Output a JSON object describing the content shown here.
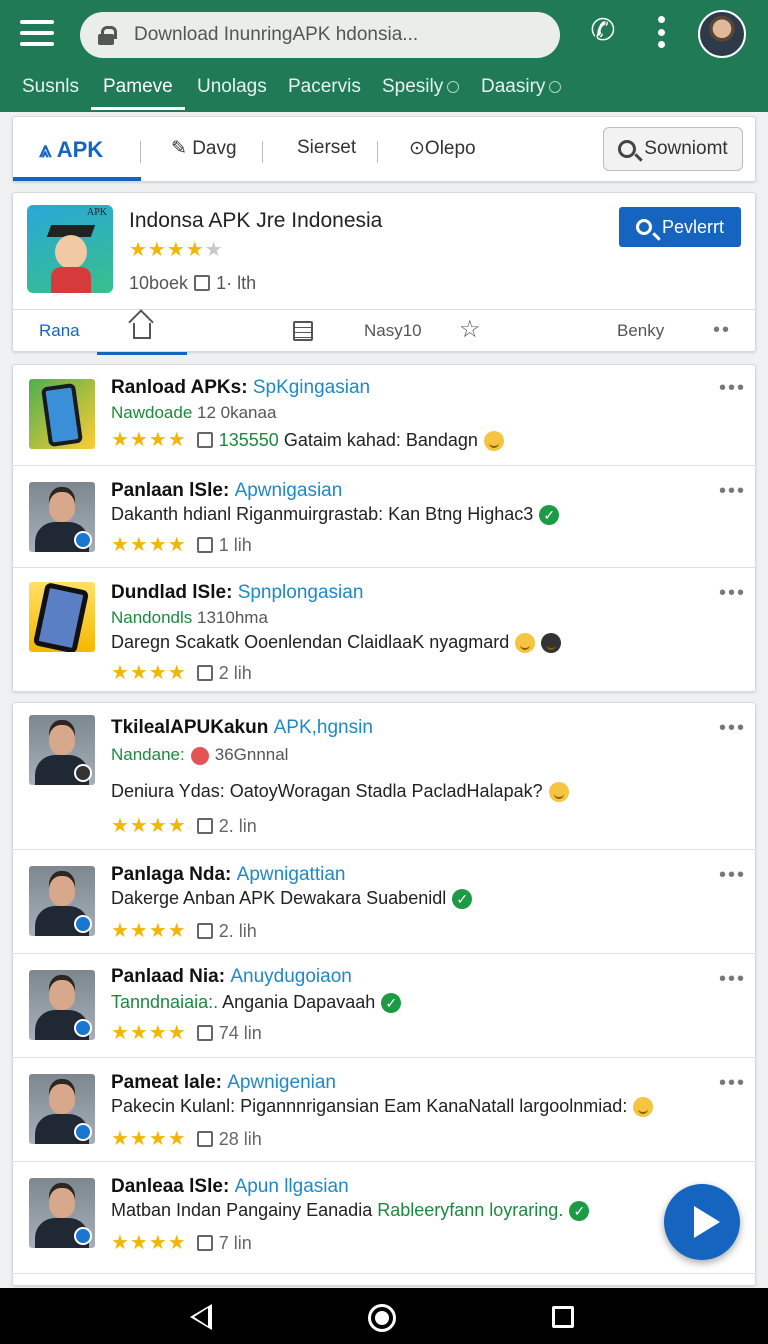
{
  "header": {
    "search_text": "Download InunringAPK hdonsia...",
    "tabs": [
      "Susnls",
      "Pameve",
      "Unolags",
      "Pacervis",
      "Spesily",
      "Daasiry"
    ]
  },
  "subtabs": {
    "apk": "APK",
    "items": [
      "Davg",
      "Sierset",
      "Olepo"
    ],
    "search_button": "Sowniomt"
  },
  "app": {
    "title": "Indonsa APK Jre Indonesia",
    "rating_stars": 3.5,
    "meta_count": "10boek",
    "meta_likes": "1",
    "meta_unit": "lth",
    "icon_tag": "APK",
    "preview_button": "Pevlerrt",
    "tabs": {
      "rana": "Rana",
      "nasy": "Nasy10",
      "benky": "Benky"
    }
  },
  "group1": [
    {
      "title": "Ranload APKs:",
      "tag": "SpKgingasian",
      "sub": "Nawdoade",
      "sub_gray": "12 0kanaa",
      "meta": "135550",
      "text2": "Gataim kahad: Bandagn"
    },
    {
      "title": "Panlaan lSle:",
      "tag": "Apwnigasian",
      "text": "Dakanth hdianl Riganmuirgrastab: Kan Btng Highac3",
      "meta": "1",
      "unit": "lih"
    },
    {
      "title": "Dundlad lSle:",
      "tag": "Spnplongasian",
      "sub": "Nandondls",
      "sub_gray": "1310hma",
      "text": "Daregn Scakatk Ooenlendan ClaidlaaK nyagmard",
      "meta": "2",
      "unit": "lih"
    }
  ],
  "group2": [
    {
      "title": "TkilealAPUKakun",
      "tag": "APK,hgnsin",
      "sub": "Nandane:",
      "sub_gray": "36Gnnnal",
      "text": "Deniura Ydas: OatoyWoragan Stadla PacladHalapak?",
      "meta": "2.",
      "unit": "lin"
    },
    {
      "title": "Panlaga Nda:",
      "tag": "Apwnigattian",
      "text": "Dakerge Anban APK Dewakara Suabenidl",
      "meta": "2.",
      "unit": "lih"
    },
    {
      "title": "Panlaad Nia:",
      "tag": "Anuydugoiaon",
      "sub": "Tanndnaiaia:.",
      "text_inline": "Angania Dapavaah",
      "meta": "74",
      "unit": "lin"
    },
    {
      "title": "Pameat lale:",
      "tag": "Apwnigenian",
      "text": "Pakecin Kulanl: Pigannnrigansian Eam KanaNatall largoolnmiad:",
      "meta": "28",
      "unit": "lih"
    },
    {
      "title": "Danleaa lSle:",
      "tag": "Apun llgasian",
      "text": "Matban Indan Pangainy Eanadia",
      "text_green": "Rableeryfann loyraring.",
      "meta": "7",
      "unit": "lin"
    }
  ],
  "colors": {
    "brand": "#1f7a55",
    "accent": "#1565c0",
    "star": "#f2b705",
    "verified": "#1c9a44"
  },
  "icons": [
    "menu-icon",
    "lock-icon",
    "phone-icon",
    "kebab-icon",
    "search-icon",
    "pen-icon",
    "pin-icon",
    "home-icon",
    "document-icon",
    "star-icon",
    "more-icon",
    "play-icon",
    "back-icon",
    "home-nav-icon",
    "recents-icon"
  ]
}
